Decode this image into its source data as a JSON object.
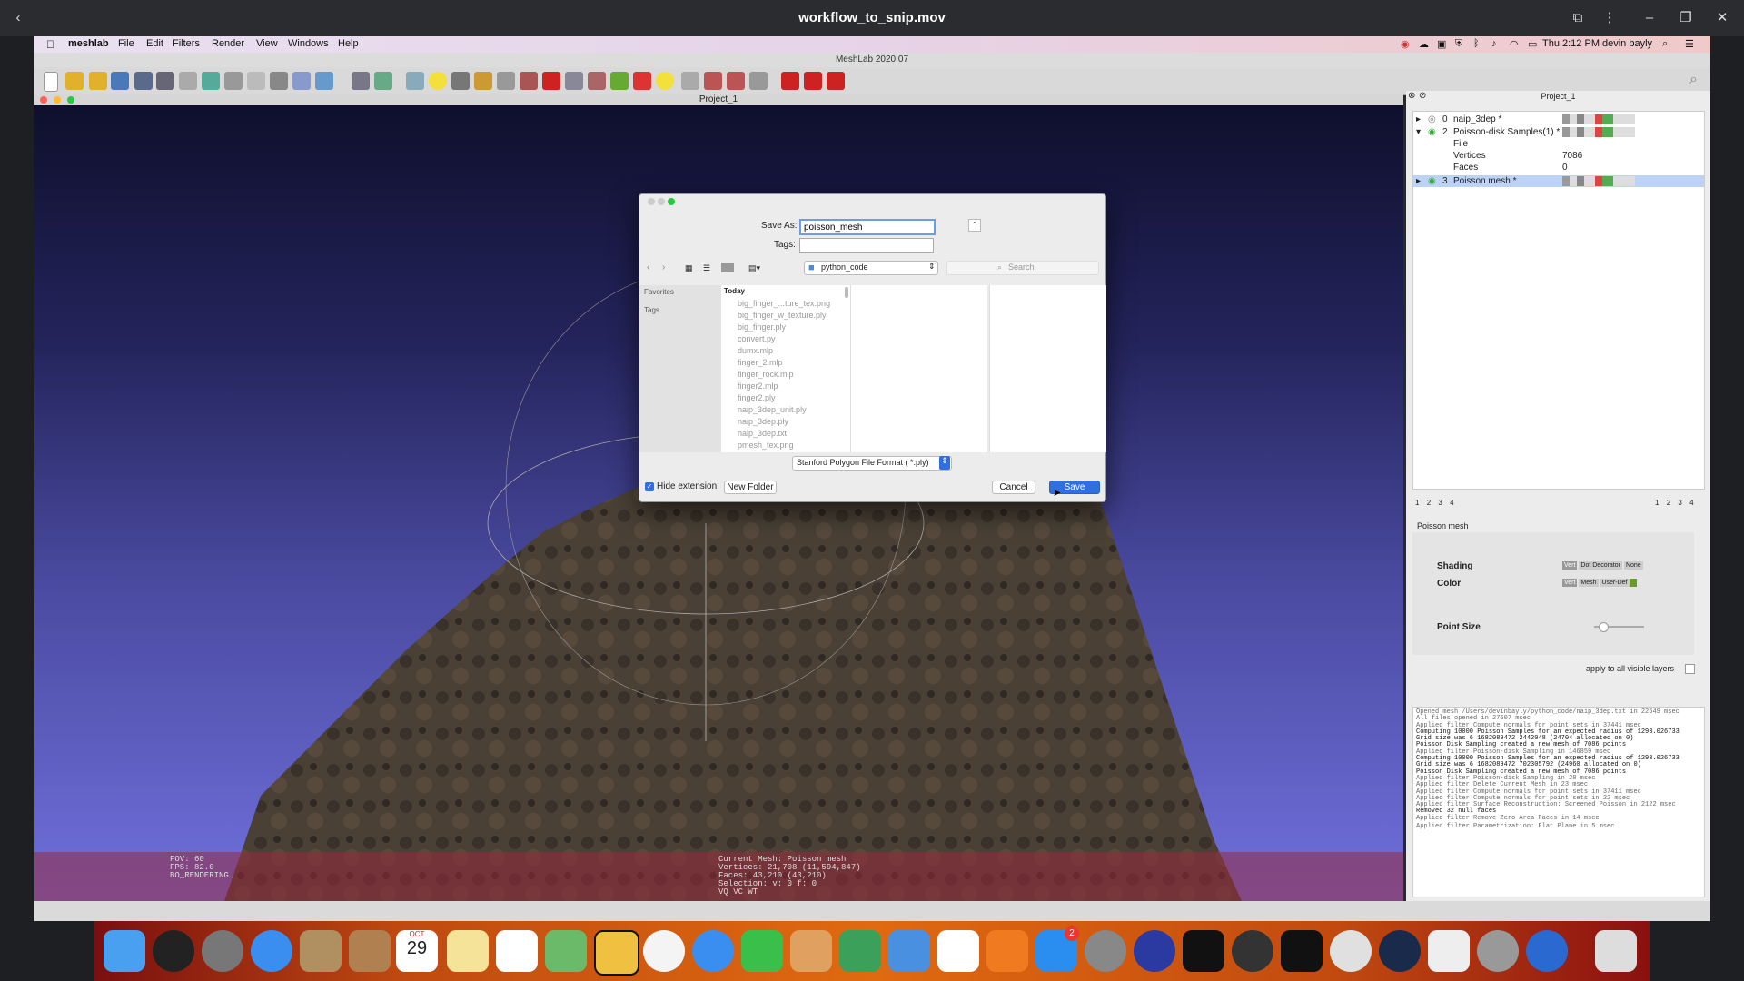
{
  "player": {
    "title": "workflow_to_snip.mov"
  },
  "menubar": {
    "app": "meshlab",
    "items": [
      "File",
      "Edit",
      "Filters",
      "Render",
      "View",
      "Windows",
      "Help"
    ],
    "clock": "Thu 2:12 PM",
    "user": "devin bayly"
  },
  "app_title": "MeshLab 2020.07",
  "doc_title": "Project_1",
  "panel_title": "Project_1",
  "layers": [
    {
      "id": "0",
      "name": "naip_3dep *"
    },
    {
      "id": "2",
      "name": "Poisson-disk Samples(1) *"
    },
    {
      "id": "3",
      "name": "Poisson mesh *"
    }
  ],
  "layer_detail": {
    "file_label": "File",
    "vertices_label": "Vertices",
    "vertices": "7086",
    "faces_label": "Faces",
    "faces": "0"
  },
  "pager_left": [
    "1",
    "2",
    "3",
    "4"
  ],
  "pager_right": [
    "1",
    "2",
    "3",
    "4"
  ],
  "props": {
    "title": "Poisson mesh",
    "shading_label": "Shading",
    "shading_opts": [
      "Vert",
      "Dot Decorator",
      "None"
    ],
    "color_label": "Color",
    "color_opts": [
      "Vert",
      "Mesh",
      "User-Def"
    ],
    "point_size_label": "Point Size",
    "apply_label": "apply to all visible layers"
  },
  "log": [
    "Opened mesh /Users/devinbayly/python_code/naip_3dep.txt in 22549 msec",
    "All files opened in 27607 msec",
    "Applied filter Compute normals for point sets in 37441 msec",
    "Computing 10000 Poisson Samples for an expected radius of 1293.026733",
    "Grid size was 6 1682089472 2442048 (24704 allocated on 0)",
    "Poisson Disk Sampling created a new mesh of 7086 points",
    "Applied filter Poisson-disk Sampling in 146859 msec",
    "Computing 10000 Poisson Samples for an expected radius of 1293.026733",
    "Grid size was 6 1682089472 702305792 (24960 allocated on 0)",
    "Poisson Disk Sampling created a new mesh of 7086 points",
    "Applied filter Poisson-disk Sampling in 28 msec",
    "Applied filter Delete Current Mesh in 23 msec",
    "Applied filter Compute normals for point sets in 37411 msec",
    "Applied filter Compute normals for point sets in 22 msec",
    "Applied filter Surface Reconstruction: Screened Poisson in 2122 msec",
    "Removed 32 null faces",
    "Applied filter Remove Zero Area Faces in 14 msec",
    "Applied filter Parametrization: Flat Plane in 5 msec"
  ],
  "viewport_info": {
    "left": [
      "FOV: 60",
      "FPS:   82.0",
      "BO_RENDERING"
    ],
    "right": [
      "Current Mesh: Poisson mesh",
      "Vertices: 21,708    (11,594,847)",
      "Faces: 43,210    (43,210)",
      "Selection: v: 0 f: 0",
      "VQ VC WT"
    ]
  },
  "dialog": {
    "save_as_label": "Save As:",
    "save_as_value": "poisson_mesh",
    "tags_label": "Tags:",
    "folder": "python_code",
    "search_placeholder": "Search",
    "sidebar": [
      "Favorites",
      "Tags"
    ],
    "group": "Today",
    "files": [
      "big_finger_...ture_tex.png",
      "big_finger_w_texture.ply",
      "big_finger.ply",
      "convert.py",
      "dumx.mlp",
      "finger_2.mlp",
      "finger_rock.mlp",
      "finger2.mlp",
      "finger2.ply",
      "naip_3dep_unit.ply",
      "naip_3dep.ply",
      "naip_3dep.txt",
      "pmesh_tex.png"
    ],
    "format": "Stanford Polygon File Format ( *.ply)",
    "hide_extension": "Hide extension",
    "new_folder": "New Folder",
    "cancel": "Cancel",
    "save": "Save"
  },
  "dock": {
    "calendar_month": "OCT",
    "calendar_day": "29",
    "badge": "2"
  },
  "colors": {
    "accent": "#2f6fe0",
    "viewport_top": "#0f0f2d",
    "viewport_bottom": "#7070dd",
    "selected_layer": "#bcd3f5"
  }
}
